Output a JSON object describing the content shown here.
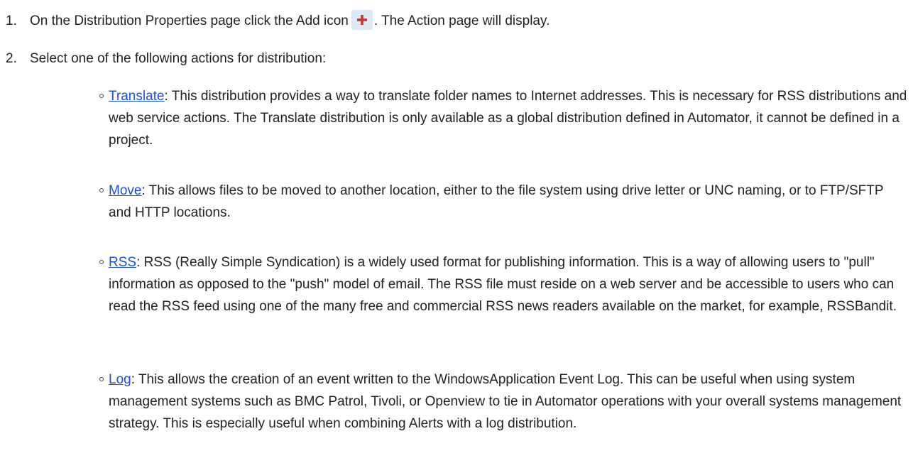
{
  "steps": [
    {
      "number": "1.",
      "before_icon": "On the Distribution Properties page click the Add icon",
      "icon": "plus-icon",
      "after_icon": ". The Action page will display."
    },
    {
      "number": "2.",
      "text": "Select one of the following actions for distribution:"
    }
  ],
  "actions": [
    {
      "link": "Translate",
      "description": ": This distribution provides a way to translate folder names to Internet addresses. This is necessary for RSS distributions and web service actions. The Translate distribution is only available as a global distribution defined in Automator, it cannot be defined in a project."
    },
    {
      "link": "Move",
      "description": ": This allows files to be moved to another location, either to the file system using drive letter or UNC naming, or to FTP/SFTP and HTTP locations."
    },
    {
      "link": "RSS",
      "description": ": RSS (Really Simple Syndication) is a widely used format for publishing information. This is a way of allowing users to \"pull\" information as opposed to the \"push\" model of email. The RSS file must reside on a web server and be accessible to users who can read the RSS feed using one of the many free and commercial RSS news readers available on the market, for example, RSSBandit."
    },
    {
      "link": "Log",
      "description": ": This allows the creation of an event written to the WindowsApplication Event Log. This can be useful when using system management systems such as BMC Patrol, Tivoli, or Openview to tie in Automator operations with your overall systems management strategy. This is especially useful when combining Alerts with a log distribution."
    }
  ],
  "colors": {
    "link": "#1a4fd8",
    "icon_bg": "#dde9f7",
    "icon_plus": "#c0392b"
  }
}
